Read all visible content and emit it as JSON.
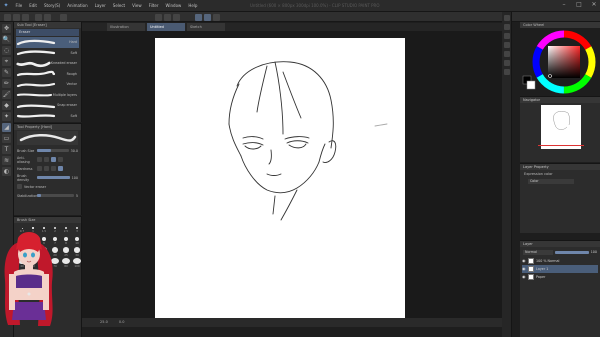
{
  "app": {
    "title": "Untitled (600 × 800px 300dpi 100.0%) - CLIP STUDIO PAINT PRO"
  },
  "menu": [
    "File",
    "Edit",
    "Story(S)",
    "Animation",
    "Layer",
    "Select",
    "View",
    "Filter",
    "Window",
    "Help"
  ],
  "window_buttons": [
    "–",
    "□",
    "✕"
  ],
  "tabs": [
    {
      "label": "Illustration"
    },
    {
      "label": "Untitled"
    },
    {
      "label": "Sketch"
    }
  ],
  "tools": [
    "✥",
    "🔍",
    "◌",
    "⌖",
    "✎",
    "✏",
    "🖌",
    "◆",
    "✦",
    "◢",
    "▭",
    "T",
    "≋",
    "◐"
  ],
  "subtool": {
    "panel_title": "Sub Tool [Eraser]",
    "group": "Eraser",
    "brushes": [
      {
        "label": "Hard"
      },
      {
        "label": "Soft"
      },
      {
        "label": "Kneaded eraser"
      },
      {
        "label": "Rough"
      },
      {
        "label": "Vector"
      },
      {
        "label": "Multiple layers"
      },
      {
        "label": "Snap eraser"
      },
      {
        "label": "Soft"
      }
    ]
  },
  "tool_property": {
    "panel_title": "Tool Property [Hard]",
    "brush_size_label": "Brush Size",
    "brush_size_value": "30.0",
    "brush_size_fill": 0.45,
    "antialiasing_label": "Anti-aliasing",
    "hardness_label": "Hardness",
    "brush_density_label": "Brush density",
    "brush_density_value": "100",
    "vector_eraser_label": "Vector eraser",
    "stabilization_label": "Stabilization",
    "stabilization_value": "5"
  },
  "brush_size_panel": {
    "panel_title": "Brush Size",
    "sizes": [
      "0.7",
      "1",
      "1.5",
      "2",
      "2.5",
      "3",
      "4",
      "5",
      "6",
      "7",
      "8",
      "10",
      "12",
      "15",
      "17",
      "20",
      "25",
      "30",
      "40",
      "50",
      "60",
      "70",
      "80",
      "100"
    ]
  },
  "status_bar": {
    "zoom": "25.0",
    "angle": "0.0",
    "coords": ""
  },
  "right_panels": {
    "color_wheel_title": "Color Wheel",
    "navigator_title": "Navigator",
    "layer_property_title": "Layer Property",
    "expression_label": "Expression color",
    "expression_value": "Color",
    "layer_panel_title": "Layer",
    "blend_mode": "Normal",
    "opacity": "100",
    "layers": [
      {
        "name": "100 % Normal",
        "selected": false
      },
      {
        "name": "Layer 1",
        "selected": true
      },
      {
        "name": "Paper",
        "selected": false
      }
    ]
  },
  "colors": {
    "accent": "#4a5e7a",
    "active_tab": "#4a5a72",
    "canvas_bg": "#1a1a1a",
    "paper": "#ffffff"
  }
}
